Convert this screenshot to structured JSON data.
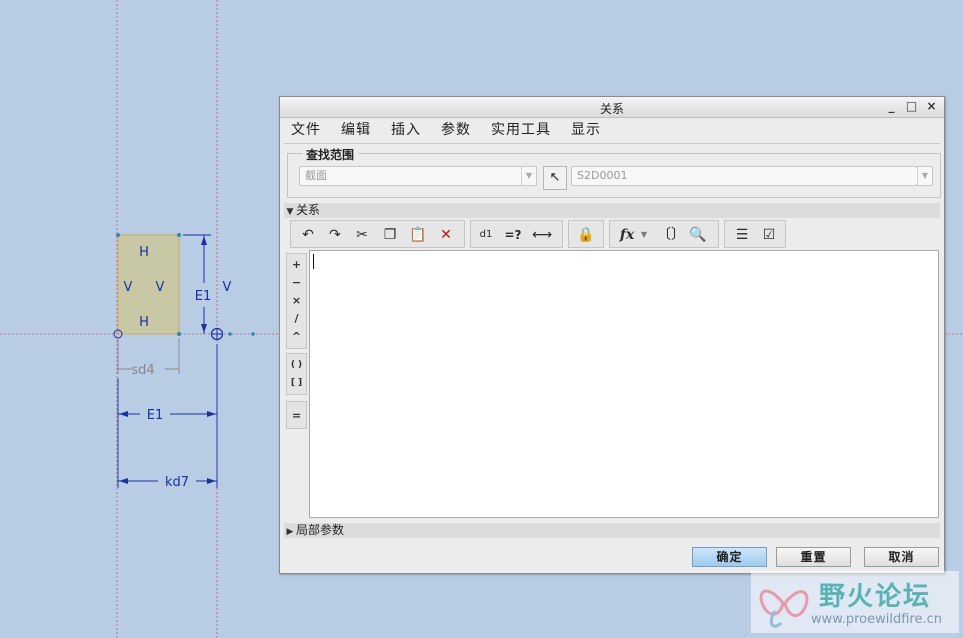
{
  "sketch": {
    "block_labels": {
      "top": "H",
      "bottom": "H",
      "left": "V",
      "right": "V"
    },
    "dim_height": "E1",
    "dim_vertical_constraint": "V",
    "dim_sd4": "sd4",
    "dim_width": "E1",
    "dim_kd7": "kd7"
  },
  "dialog": {
    "title": "关系",
    "window_controls": {
      "minimize": "_",
      "maximize": "□",
      "close": "×"
    },
    "menu": [
      "文件",
      "编辑",
      "插入",
      "参数",
      "实用工具",
      "显示"
    ],
    "scope": {
      "legend": "查找范围",
      "type_value": "截面",
      "name_value": "S2D0001"
    },
    "relations_section": "关系",
    "toolbar_icons": [
      "undo-icon",
      "redo-icon",
      "cut-icon",
      "copy-icon",
      "paste-icon",
      "delete-icon",
      "switch-dims-icon",
      "evaluate-icon",
      "measure-icon",
      "lock-icon",
      "function-icon",
      "parameter-icon",
      "check-icon",
      "sort-icon",
      "verify-icon"
    ],
    "toolbar_text": {
      "evaluate": "=?",
      "function": "fx"
    },
    "operators": [
      "+",
      "−",
      "×",
      "/",
      "^",
      "( )",
      "[ ]",
      "="
    ],
    "editor_text": "",
    "local_params_section": "局部参数",
    "buttons": {
      "ok": "确定",
      "reset": "重置",
      "cancel": "取消"
    }
  },
  "watermark": {
    "title": "野火论坛",
    "url": "www.proewildfire.cn"
  },
  "colors": {
    "background": "#b8cce4",
    "sketch_blue": "#1a2fa8",
    "block_fill": "#c8c8a4",
    "primary_button": "#a9d2f2"
  }
}
